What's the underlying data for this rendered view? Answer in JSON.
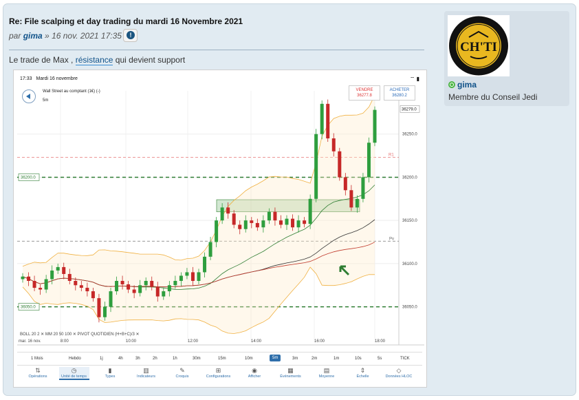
{
  "post": {
    "title": "Re: File scalping et day trading du mardi 16 Novembre 2021",
    "by_prefix": "par",
    "author": "gima",
    "by_sep": "»",
    "date": "16 nov. 2021 17:35",
    "report_icon": "!",
    "text_before": "Le trade de Max ,",
    "text_link": "résistance",
    "text_after": " qui devient support"
  },
  "screenshot": {
    "time": "17:33",
    "date": "Mardi 16 novembre",
    "status_icons": "⌔ ▮",
    "instrument": "Wall Street au comptant (1€) (-)",
    "timeframe": "5m",
    "sell": {
      "label": "VENDRE",
      "price": "36277.8"
    },
    "buy": {
      "label": "ACHETER",
      "price": "36280.2"
    },
    "indicators": "BOLL 20 2 ✕    MM 20 50 100 ✕    PIVOT QUOTIDIEN (H+B+C)/3 ✕",
    "timeframes": [
      "1 Mois",
      "Hebdo",
      "1j",
      "4h",
      "3h",
      "2h",
      "1h",
      "30m",
      "15m",
      "10m",
      "5m",
      "3m",
      "2m",
      "1m",
      "10s",
      "5s",
      "TICK"
    ],
    "active_timeframe": "5m",
    "tools": [
      {
        "label": "Opérations",
        "icon": "⇅"
      },
      {
        "label": "Unité de temps",
        "icon": "◷"
      },
      {
        "label": "Types",
        "icon": "▮"
      },
      {
        "label": "Indicateurs",
        "icon": "▥"
      },
      {
        "label": "Croquis",
        "icon": "✎"
      },
      {
        "label": "Configurations",
        "icon": "⊞"
      },
      {
        "label": "Afficher",
        "icon": "◉"
      },
      {
        "label": "Événements",
        "icon": "▦"
      },
      {
        "label": "Moyenne",
        "icon": "▤"
      },
      {
        "label": "Échelle",
        "icon": "⇕"
      },
      {
        "label": "Données HLOC",
        "icon": "◇"
      }
    ],
    "active_tool": "Unité de temps"
  },
  "chart_data": {
    "type": "candlestick",
    "x_tick_labels": [
      "mar. 16 nov.",
      "8:00",
      "10:00",
      "12:00",
      "14:00",
      "16:00",
      "18:00"
    ],
    "y_tick_labels": [
      "36250.0",
      "36200.0",
      "36150.0",
      "36100.0",
      "36050.0"
    ],
    "last_price_label": "36279.0",
    "left_level_labels": [
      "36200.0",
      "36050.0"
    ],
    "levels": {
      "R1": "R1",
      "Pv": "Pv"
    },
    "resistance_zone": [
      36160,
      36174
    ],
    "ylim": [
      36025,
      36300
    ],
    "colors": {
      "up": "#2e9e3e",
      "down": "#c62828",
      "bollinger": "#f0b040",
      "ma_fast": "#2e7d32",
      "ma_mid": "#333333",
      "ma_slow": "#c0392b"
    }
  },
  "profile": {
    "username": "gima",
    "rank": "Membre du Conseil Jedi",
    "avatar_text": "CH'TI",
    "avatar_ring_text": "BIERE DE GARDE ★ BLONDE ★ A L'ANCIENNE DU NORD"
  }
}
